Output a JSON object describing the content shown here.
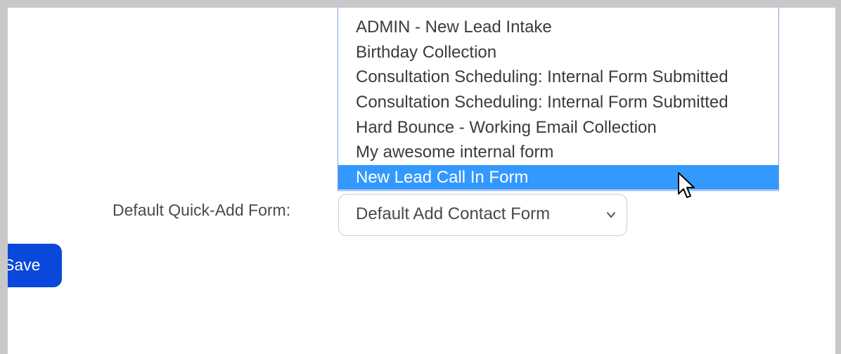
{
  "dropdown": {
    "options": [
      {
        "label": "ADMIN - New Lead Intake"
      },
      {
        "label": "Birthday Collection"
      },
      {
        "label": "Consultation Scheduling: Internal Form Submitted"
      },
      {
        "label": "Consultation Scheduling: Internal Form Submitted"
      },
      {
        "label": "Hard Bounce - Working Email Collection"
      },
      {
        "label": "My awesome internal form"
      },
      {
        "label": "New Lead Call In Form"
      }
    ],
    "highlighted_option": "New Lead Call In Form"
  },
  "quick_add": {
    "label": "Default Quick-Add Form:",
    "selected_value": "Default Add Contact Form"
  },
  "actions": {
    "save_label": "Save"
  },
  "colors": {
    "highlight": "#3399ff",
    "save_button": "#0a48db",
    "dropdown_border": "#7d9ce8"
  },
  "icons": {
    "select_indicator": "chevron-down-icon",
    "pointer": "mouse-pointer-icon"
  }
}
